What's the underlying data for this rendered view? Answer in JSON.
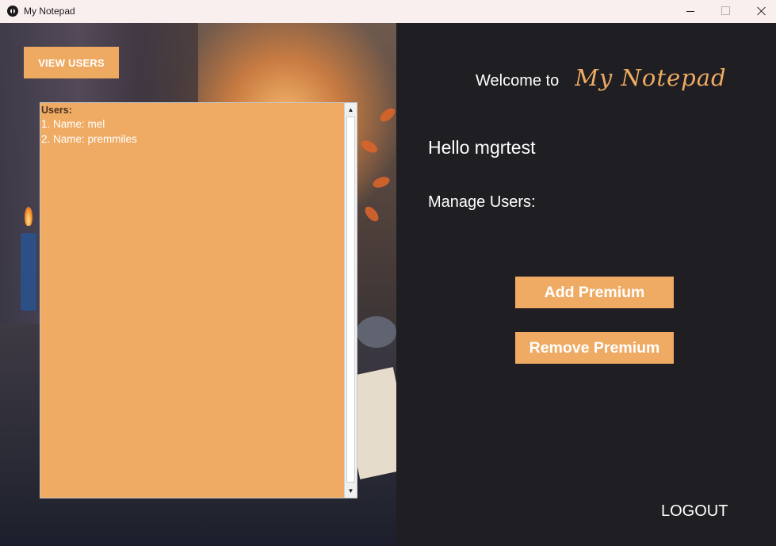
{
  "window": {
    "title": "My Notepad",
    "controls": [
      "minimize",
      "maximize",
      "close"
    ]
  },
  "left": {
    "view_users_label": "VIEW USERS",
    "users_list": {
      "header": "Users:",
      "items": [
        "1. Name: mel",
        "2. Name: premmiles"
      ]
    }
  },
  "right": {
    "welcome": "Welcome to",
    "brand": "My Notepad",
    "greeting": "Hello mgrtest",
    "manage_label": "Manage Users:",
    "add_premium_label": "Add Premium",
    "remove_premium_label": "Remove Premium",
    "logout_label": "LOGOUT"
  },
  "colors": {
    "accent": "#efab63",
    "panel_bg": "#1f1e22",
    "titlebar_bg": "#f9efee",
    "text": "#ffffff"
  }
}
